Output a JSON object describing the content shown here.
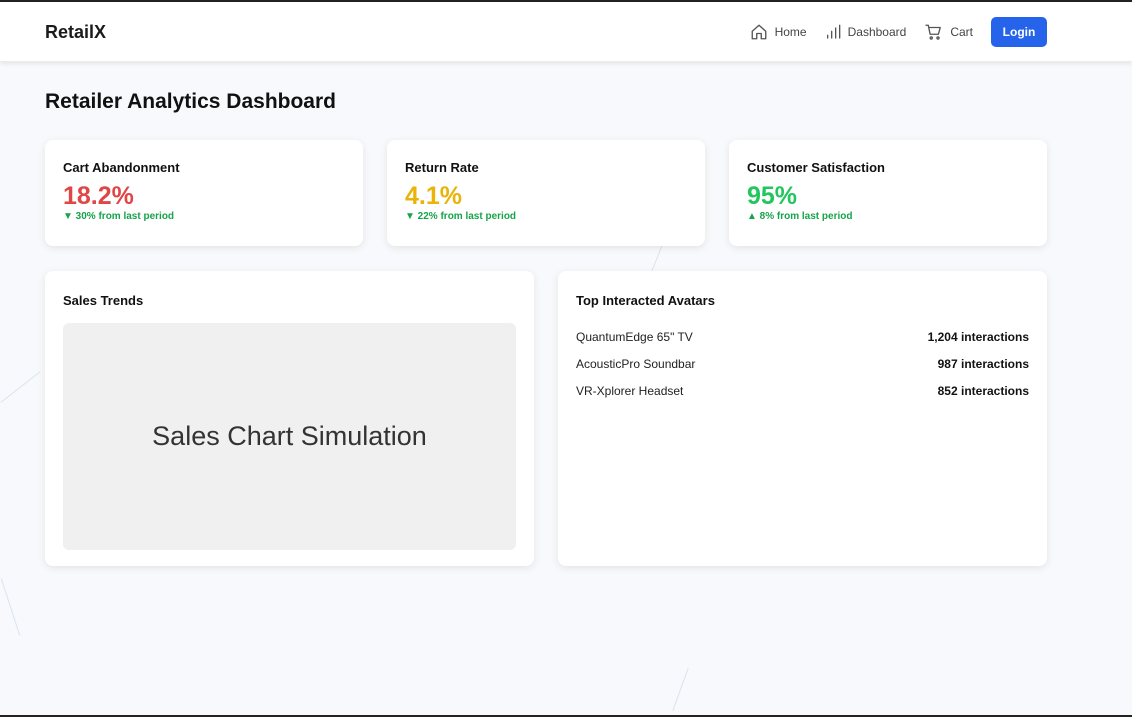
{
  "header": {
    "brand": "RetailX",
    "nav": [
      {
        "label": "Home",
        "icon": "home-icon"
      },
      {
        "label": "Dashboard",
        "icon": "bar-chart-icon"
      },
      {
        "label": "Cart",
        "icon": "cart-icon"
      }
    ],
    "login_label": "Login"
  },
  "page": {
    "title": "Retailer Analytics Dashboard"
  },
  "kpis": [
    {
      "title": "Cart Abandonment",
      "value": "18.2%",
      "change": "▼ 30% from last period",
      "color": "#e04646"
    },
    {
      "title": "Return Rate",
      "value": "4.1%",
      "change": "▼ 22% from last period",
      "color": "#eab308"
    },
    {
      "title": "Customer Satisfaction",
      "value": "95%",
      "change": "▲ 8% from last period",
      "color": "#22c55e"
    }
  ],
  "sales": {
    "title": "Sales Trends",
    "placeholder": "Sales Chart Simulation"
  },
  "avatars": {
    "title": "Top Interacted Avatars",
    "items": [
      {
        "name": "QuantumEdge 65\" TV",
        "count": "1,204 interactions"
      },
      {
        "name": "AcousticPro Soundbar",
        "count": "987 interactions"
      },
      {
        "name": "VR-Xplorer Headset",
        "count": "852 interactions"
      }
    ]
  },
  "colors": {
    "accent": "#2563eb",
    "positive": "#16a34a"
  }
}
